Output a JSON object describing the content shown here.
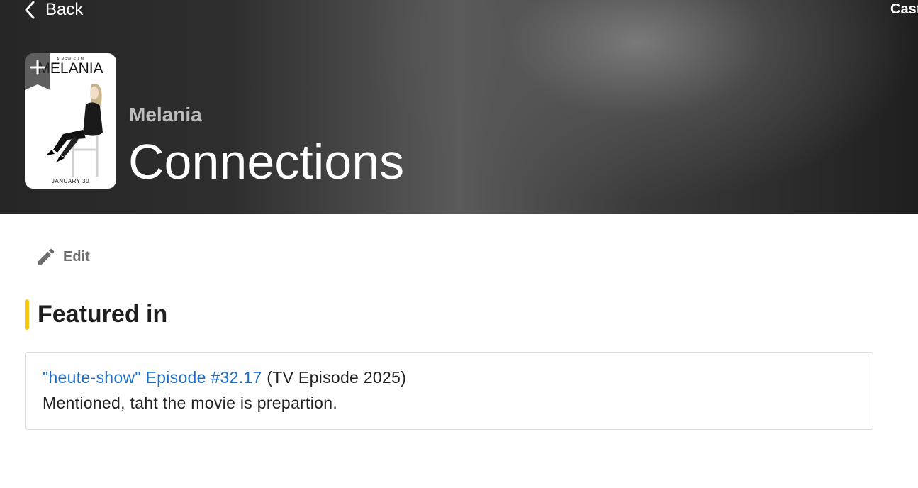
{
  "nav": {
    "back_label": "Back",
    "cast_label": "Cast"
  },
  "poster": {
    "tagline": "A NEW FILM",
    "title": "MELANIA",
    "date": "JANUARY 30",
    "alt_icon": "person-seated-icon"
  },
  "header": {
    "subtitle": "Melania",
    "title": "Connections"
  },
  "actions": {
    "edit_label": "Edit"
  },
  "section": {
    "title": "Featured in",
    "accent_color": "#f5c518"
  },
  "items": [
    {
      "link_text": "\"heute-show\" Episode #32.17",
      "suffix": " (TV Episode 2025)",
      "note": "Mentioned, taht the movie is prepartion."
    }
  ],
  "colors": {
    "link": "#1d6ec5",
    "text": "#222222",
    "muted": "#6e6e6e"
  }
}
